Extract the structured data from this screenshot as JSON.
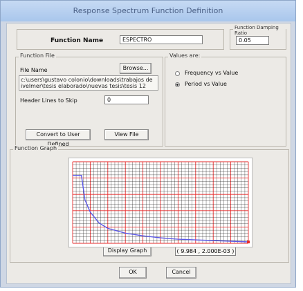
{
  "window": {
    "title": "Response Spectrum Function Definition"
  },
  "function_name": {
    "label": "Function Name",
    "value": "ESPECTRO"
  },
  "damping": {
    "label": "Function Damping Ratio",
    "value": "0.05"
  },
  "function_file": {
    "group_label": "Function File",
    "file_name_label": "File Name",
    "browse_label": "Browse...",
    "path_line1": "c:\\users\\gustavo colonio\\downloads\\trabajos de",
    "path_line2": "ivelmer\\tesis elaborado\\nuevas tesis\\tesis 12",
    "header_lines_label": "Header Lines to Skip",
    "header_lines_value": "0",
    "convert_label": "Convert to User Defined",
    "view_label": "View File"
  },
  "values_are": {
    "group_label": "Values are:",
    "options": [
      "Frequency vs Value",
      "Period vs Value"
    ],
    "selected": "Period vs Value"
  },
  "graph": {
    "group_label": "Function Graph",
    "display_label": "Display Graph",
    "readout": "( 9.984 , 2.000E-03 )"
  },
  "buttons": {
    "ok": "OK",
    "cancel": "Cancel"
  },
  "chart_data": {
    "type": "line",
    "x": [
      0,
      0.2,
      0.5,
      0.7,
      1.0,
      1.5,
      2.0,
      3.0,
      4.0,
      5.0,
      6.0,
      8.0,
      10.0
    ],
    "y": [
      0.5,
      0.5,
      0.5,
      0.32,
      0.23,
      0.15,
      0.11,
      0.075,
      0.055,
      0.04,
      0.03,
      0.02,
      0.01
    ],
    "xlim": [
      0,
      10
    ],
    "ylim": [
      0,
      0.6
    ],
    "grid": true,
    "colors": {
      "line": "#5a57e6",
      "major_grid": "#e62a2a",
      "minor_grid": "#222222",
      "end_marker": "#e62a2a"
    }
  }
}
